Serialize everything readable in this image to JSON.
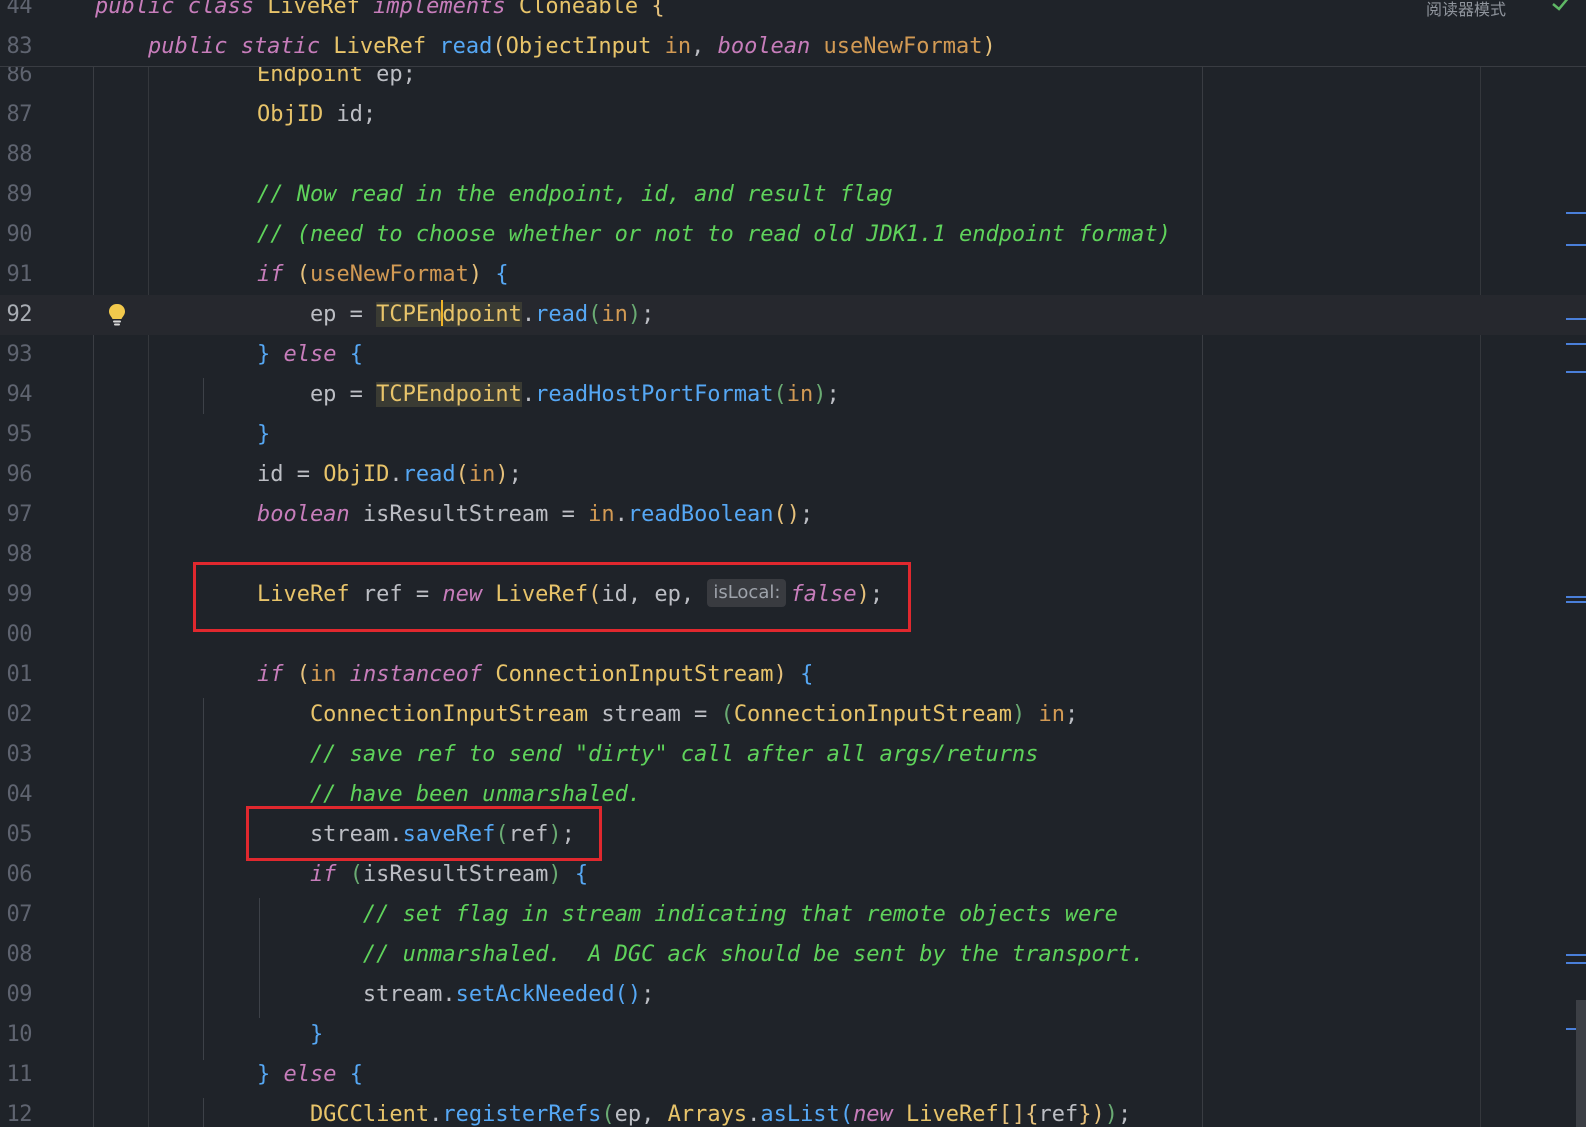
{
  "sticky": {
    "lines": [
      {
        "num": "44",
        "tokens": [
          {
            "t": "public class ",
            "c": "kw"
          },
          {
            "t": "LiveRef ",
            "c": "cls"
          },
          {
            "t": "implements ",
            "c": "kw"
          },
          {
            "t": "Cloneable ",
            "c": "cls"
          },
          {
            "t": "{",
            "c": "br-y"
          }
        ]
      },
      {
        "num": "83",
        "tokens": [
          {
            "t": "    public static ",
            "c": "kw"
          },
          {
            "t": "LiveRef ",
            "c": "cls"
          },
          {
            "t": "read",
            "c": "fn"
          },
          {
            "t": "(",
            "c": "br-y"
          },
          {
            "t": "ObjectInput ",
            "c": "cls"
          },
          {
            "t": "in",
            "c": "pa"
          },
          {
            "t": ", ",
            "c": "op"
          },
          {
            "t": "boolean ",
            "c": "kw"
          },
          {
            "t": "useNewFormat",
            "c": "pa"
          },
          {
            "t": ")",
            "c": "br-y"
          }
        ]
      }
    ],
    "reader_mode": "阅读器模式"
  },
  "editor": {
    "lines": [
      {
        "num": "86",
        "tokens": [
          {
            "t": "        Endpoint ",
            "c": "cls"
          },
          {
            "t": "ep;",
            "c": "op"
          }
        ]
      },
      {
        "num": "87",
        "tokens": [
          {
            "t": "        ObjID ",
            "c": "cls"
          },
          {
            "t": "id;",
            "c": "op"
          }
        ]
      },
      {
        "num": "88",
        "tokens": []
      },
      {
        "num": "89",
        "tokens": [
          {
            "t": "        // Now read in the endpoint, id, and result flag",
            "c": "cm"
          }
        ]
      },
      {
        "num": "90",
        "tokens": [
          {
            "t": "        // (need to choose whether or not to read old JDK1.1 endpoint format)",
            "c": "cm"
          }
        ]
      },
      {
        "num": "91",
        "tokens": [
          {
            "t": "        if ",
            "c": "kw"
          },
          {
            "t": "(",
            "c": "br-y"
          },
          {
            "t": "useNewFormat",
            "c": "pa"
          },
          {
            "t": ") ",
            "c": "br-y"
          },
          {
            "t": "{",
            "c": "br-b"
          }
        ]
      },
      {
        "num": "92",
        "current": true,
        "tokens": [
          {
            "t": "            ep = ",
            "c": "op"
          },
          {
            "t": "TCPEn",
            "c": "cls hl-cls"
          },
          {
            "caret": true
          },
          {
            "t": "dpoint",
            "c": "cls hl-cls"
          },
          {
            "t": ".",
            "c": "op"
          },
          {
            "t": "read",
            "c": "fn"
          },
          {
            "t": "(",
            "c": "br-g"
          },
          {
            "t": "in",
            "c": "pa"
          },
          {
            "t": ")",
            "c": "br-g"
          },
          {
            "t": ";",
            "c": "op"
          }
        ]
      },
      {
        "num": "93",
        "tokens": [
          {
            "t": "        } ",
            "c": "br-b"
          },
          {
            "t": "else ",
            "c": "kw"
          },
          {
            "t": "{",
            "c": "br-b"
          }
        ]
      },
      {
        "num": "94",
        "tokens": [
          {
            "t": "            ep = ",
            "c": "op"
          },
          {
            "t": "TCPEndpoint",
            "c": "cls hl-cls"
          },
          {
            "t": ".",
            "c": "op"
          },
          {
            "t": "readHostPortFormat",
            "c": "fn"
          },
          {
            "t": "(",
            "c": "br-g"
          },
          {
            "t": "in",
            "c": "pa"
          },
          {
            "t": ")",
            "c": "br-g"
          },
          {
            "t": ";",
            "c": "op"
          }
        ]
      },
      {
        "num": "95",
        "tokens": [
          {
            "t": "        }",
            "c": "br-b"
          }
        ]
      },
      {
        "num": "96",
        "tokens": [
          {
            "t": "        id = ",
            "c": "op"
          },
          {
            "t": "ObjID",
            "c": "cls"
          },
          {
            "t": ".",
            "c": "op"
          },
          {
            "t": "read",
            "c": "fn"
          },
          {
            "t": "(",
            "c": "br-y"
          },
          {
            "t": "in",
            "c": "pa"
          },
          {
            "t": ")",
            "c": "br-y"
          },
          {
            "t": ";",
            "c": "op"
          }
        ]
      },
      {
        "num": "97",
        "tokens": [
          {
            "t": "        boolean ",
            "c": "kw"
          },
          {
            "t": "isResultStream = ",
            "c": "op"
          },
          {
            "t": "in",
            "c": "pa"
          },
          {
            "t": ".",
            "c": "op"
          },
          {
            "t": "readBoolean",
            "c": "fn"
          },
          {
            "t": "()",
            "c": "br-y"
          },
          {
            "t": ";",
            "c": "op"
          }
        ]
      },
      {
        "num": "98",
        "tokens": []
      },
      {
        "num": "99",
        "tokens": [
          {
            "t": "        LiveRef ",
            "c": "cls"
          },
          {
            "t": "ref = ",
            "c": "op"
          },
          {
            "t": "new ",
            "c": "kw"
          },
          {
            "t": "LiveRef",
            "c": "cls"
          },
          {
            "t": "(",
            "c": "br-y"
          },
          {
            "t": "id, ep, ",
            "c": "op"
          },
          {
            "hint": "isLocal:"
          },
          {
            "t": "false",
            "c": "kw"
          },
          {
            "t": ")",
            "c": "br-y"
          },
          {
            "t": ";",
            "c": "op"
          }
        ]
      },
      {
        "num": "00",
        "tokens": []
      },
      {
        "num": "01",
        "tokens": [
          {
            "t": "        if ",
            "c": "kw"
          },
          {
            "t": "(",
            "c": "br-y"
          },
          {
            "t": "in ",
            "c": "pa"
          },
          {
            "t": "instanceof ",
            "c": "kw"
          },
          {
            "t": "ConnectionInputStream",
            "c": "cls"
          },
          {
            "t": ") ",
            "c": "br-y"
          },
          {
            "t": "{",
            "c": "br-b"
          }
        ]
      },
      {
        "num": "02",
        "tokens": [
          {
            "t": "            ConnectionInputStream ",
            "c": "cls"
          },
          {
            "t": "stream = ",
            "c": "op"
          },
          {
            "t": "(",
            "c": "br-g"
          },
          {
            "t": "ConnectionInputStream",
            "c": "cls"
          },
          {
            "t": ") ",
            "c": "br-g"
          },
          {
            "t": "in",
            "c": "pa"
          },
          {
            "t": ";",
            "c": "op"
          }
        ]
      },
      {
        "num": "03",
        "tokens": [
          {
            "t": "            // save ref to send \"dirty\" call after all args/returns",
            "c": "cm"
          }
        ]
      },
      {
        "num": "04",
        "tokens": [
          {
            "t": "            // have been unmarshaled.",
            "c": "cm"
          }
        ]
      },
      {
        "num": "05",
        "tokens": [
          {
            "t": "            stream.",
            "c": "op"
          },
          {
            "t": "saveRef",
            "c": "fn"
          },
          {
            "t": "(",
            "c": "br-g"
          },
          {
            "t": "ref",
            "c": "op"
          },
          {
            "t": ")",
            "c": "br-g"
          },
          {
            "t": ";",
            "c": "op"
          }
        ]
      },
      {
        "num": "06",
        "tokens": [
          {
            "t": "            if ",
            "c": "kw"
          },
          {
            "t": "(",
            "c": "br-g"
          },
          {
            "t": "isResultStream",
            "c": "op"
          },
          {
            "t": ") ",
            "c": "br-g"
          },
          {
            "t": "{",
            "c": "br-b"
          }
        ]
      },
      {
        "num": "07",
        "tokens": [
          {
            "t": "                // set flag in stream indicating that remote objects were",
            "c": "cm"
          }
        ]
      },
      {
        "num": "08",
        "tokens": [
          {
            "t": "                // unmarshaled.  A DGC ack should be sent by the transport.",
            "c": "cm"
          }
        ]
      },
      {
        "num": "09",
        "tokens": [
          {
            "t": "                stream.",
            "c": "op"
          },
          {
            "t": "setAckNeeded",
            "c": "fn"
          },
          {
            "t": "()",
            "c": "br-b"
          },
          {
            "t": ";",
            "c": "op"
          }
        ]
      },
      {
        "num": "10",
        "tokens": [
          {
            "t": "            }",
            "c": "br-b"
          }
        ]
      },
      {
        "num": "11",
        "tokens": [
          {
            "t": "        } ",
            "c": "br-b"
          },
          {
            "t": "else ",
            "c": "kw"
          },
          {
            "t": "{",
            "c": "br-b"
          }
        ]
      },
      {
        "num": "12",
        "tokens": [
          {
            "t": "            DGCClient",
            "c": "cls"
          },
          {
            "t": ".",
            "c": "op"
          },
          {
            "t": "registerRefs",
            "c": "fn"
          },
          {
            "t": "(",
            "c": "br-g"
          },
          {
            "t": "ep, ",
            "c": "op"
          },
          {
            "t": "Arrays",
            "c": "cls"
          },
          {
            "t": ".",
            "c": "op"
          },
          {
            "t": "asList",
            "c": "fn"
          },
          {
            "t": "(",
            "c": "br-b"
          },
          {
            "t": "new ",
            "c": "kw"
          },
          {
            "t": "LiveRef",
            "c": "cls"
          },
          {
            "t": "[]{",
            "c": "br-y"
          },
          {
            "t": "ref",
            "c": "op"
          },
          {
            "t": "})",
            "c": "br-y"
          },
          {
            "t": ")",
            "c": "br-g"
          },
          {
            "t": ";",
            "c": "op"
          }
        ]
      }
    ]
  },
  "icons": {
    "intention_bulb": "lightbulb-icon",
    "inspection_status": "check-icon"
  }
}
